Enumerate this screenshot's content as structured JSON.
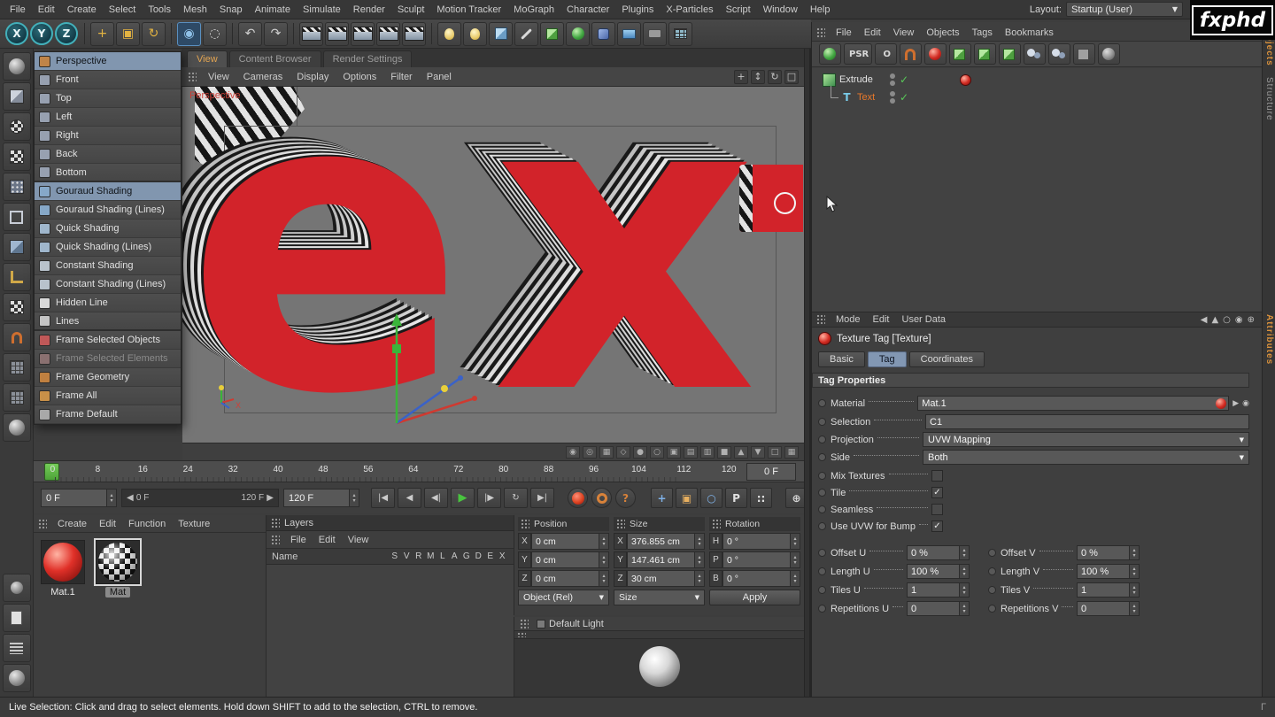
{
  "colors": {
    "accent_orange": "#e2a452",
    "selection_blue": "#8297b3",
    "viewport_gray": "#757575",
    "object_red": "#d2232a",
    "check_green": "#58c858"
  },
  "menubar": {
    "items": [
      "File",
      "Edit",
      "Create",
      "Select",
      "Tools",
      "Mesh",
      "Snap",
      "Animate",
      "Simulate",
      "Render",
      "Sculpt",
      "Motion Tracker",
      "MoGraph",
      "Character",
      "Plugins",
      "X-Particles",
      "Script",
      "Window",
      "Help"
    ],
    "layout_label": "Layout:",
    "layout_value": "Startup (User)",
    "logo": "fxphd"
  },
  "main_toolbar": {
    "axis": [
      {
        "name": "lock-x-axis-button",
        "glyph": "X"
      },
      {
        "name": "lock-y-axis-button",
        "glyph": "Y"
      },
      {
        "name": "lock-z-axis-button",
        "glyph": "Z"
      }
    ],
    "transform_tools": [
      {
        "name": "move-tool-button",
        "glyph": "+",
        "color": "#e3b341"
      },
      {
        "name": "scale-tool-button",
        "glyph": "▣",
        "color": "#e3b341"
      },
      {
        "name": "rotate-tool-button",
        "glyph": "↻",
        "color": "#e3b341"
      }
    ],
    "selection_tools": [
      {
        "name": "live-selection-tool-button",
        "glyph": "◉",
        "color": "#8fc1e8",
        "selected": true
      },
      {
        "name": "rectangle-selection-tool-button",
        "glyph": "◌",
        "color": "#cfcfcf"
      }
    ],
    "history": [
      {
        "name": "undo-button",
        "glyph": "↶"
      },
      {
        "name": "redo-button",
        "glyph": "↷"
      }
    ],
    "render_buttons": [
      {
        "name": "render-view-button"
      },
      {
        "name": "render-region-button"
      },
      {
        "name": "render-picture-viewer-button"
      },
      {
        "name": "render-team-button"
      },
      {
        "name": "render-settings-button"
      }
    ],
    "create_buttons": [
      {
        "name": "add-light-button",
        "shape": "bulb"
      },
      {
        "name": "add-light2-button",
        "shape": "bulb"
      },
      {
        "name": "add-cube-button",
        "shape": "bluecube"
      },
      {
        "name": "add-spline-button",
        "shape": "pen"
      },
      {
        "name": "add-generator-button",
        "shape": "greencube"
      },
      {
        "name": "add-mograph-button",
        "shape": "greenball"
      },
      {
        "name": "add-deformer-button",
        "shape": "bluedeform"
      },
      {
        "name": "add-environment-button",
        "shape": "sky"
      },
      {
        "name": "add-camera-button",
        "shape": "cam"
      },
      {
        "name": "add-array-button",
        "shape": "gridico"
      }
    ]
  },
  "left_toolbar": {
    "icons": [
      {
        "name": "make-editable-icon",
        "shape": "ball"
      },
      {
        "name": "model-mode-icon",
        "shape": "cube"
      },
      {
        "name": "texture-mode-icon",
        "shape": "checkerball"
      },
      {
        "name": "workplane-mode-icon",
        "shape": "checker"
      },
      {
        "name": "points-mode-icon",
        "shape": "dotcube"
      },
      {
        "name": "edges-mode-icon",
        "shape": "wirecube"
      },
      {
        "name": "polygons-mode-icon",
        "shape": "cube2"
      },
      {
        "name": "axis-mode-icon",
        "shape": "axis"
      },
      {
        "name": "texture-axis-mode-icon",
        "shape": "checker"
      },
      {
        "name": "snap-icon",
        "shape": "magnet"
      },
      {
        "name": "workplane-icon",
        "shape": "grid"
      },
      {
        "name": "locked-workplane-icon",
        "shape": "grid"
      },
      {
        "name": "viewport-solo-icon",
        "shape": "ball"
      }
    ],
    "bottom_icons": [
      {
        "name": "coordinates-icon",
        "shape": "grayball"
      },
      {
        "name": "content-browser-icon",
        "shape": "page"
      },
      {
        "name": "structure-list-icon",
        "shape": "lines"
      },
      {
        "name": "picture-viewer-icon",
        "shape": "ball"
      }
    ]
  },
  "view_menu": {
    "items": [
      {
        "label": "Perspective",
        "selected": true,
        "icon_color": "#c08448"
      },
      {
        "label": "Front",
        "icon_color": "#97a0b0"
      },
      {
        "label": "Top",
        "icon_color": "#97a0b0"
      },
      {
        "label": "Left",
        "icon_color": "#97a0b0"
      },
      {
        "label": "Right",
        "icon_color": "#97a0b0"
      },
      {
        "label": "Back",
        "icon_color": "#97a0b0"
      },
      {
        "label": "Bottom",
        "icon_color": "#97a0b0",
        "group_end": true
      },
      {
        "label": "Gouraud Shading",
        "selected": true,
        "icon_color": "#86a8c8"
      },
      {
        "label": "Gouraud Shading (Lines)",
        "icon_color": "#86a8c8"
      },
      {
        "label": "Quick Shading",
        "icon_color": "#9fb6cc"
      },
      {
        "label": "Quick Shading (Lines)",
        "icon_color": "#9fb6cc"
      },
      {
        "label": "Constant Shading",
        "icon_color": "#b8c2cc"
      },
      {
        "label": "Constant Shading (Lines)",
        "icon_color": "#b8c2cc"
      },
      {
        "label": "Hidden Line",
        "icon_color": "#d8d8d8"
      },
      {
        "label": "Lines",
        "icon_color": "#c4c4c4",
        "group_end": true
      },
      {
        "label": "Frame Selected Objects",
        "icon_color": "#c05858"
      },
      {
        "label": "Frame Selected Elements",
        "disabled": true,
        "icon_color": "#8a7070"
      },
      {
        "label": "Frame Geometry",
        "icon_color": "#c08040"
      },
      {
        "label": "Frame All",
        "icon_color": "#c89048"
      },
      {
        "label": "Frame Default",
        "icon_color": "#a8a8a8"
      }
    ]
  },
  "viewport": {
    "tabs": [
      {
        "label": "View",
        "active": true
      },
      {
        "label": "Content Browser"
      },
      {
        "label": "Render Settings"
      }
    ],
    "menu": [
      "View",
      "Cameras",
      "Display",
      "Options",
      "Filter",
      "Panel"
    ],
    "view_icons": [
      {
        "name": "pan-view-icon",
        "glyph": "+"
      },
      {
        "name": "dolly-view-icon",
        "glyph": "↕"
      },
      {
        "name": "rotate-view-icon",
        "glyph": "↻"
      },
      {
        "name": "maximize-view-icon",
        "glyph": "□"
      }
    ],
    "label": "Perspective",
    "object_text": "ex",
    "bottom_icons": [
      {
        "name": "camera-lock-icon",
        "glyph": "◉"
      },
      {
        "name": "camera-icon",
        "glyph": "◎"
      },
      {
        "name": "grid-toggle-icon",
        "glyph": "▦"
      },
      {
        "name": "axis-toggle-icon",
        "glyph": "◇"
      },
      {
        "name": "shading-icon",
        "glyph": "●"
      },
      {
        "name": "wireframe-icon",
        "glyph": "○"
      },
      {
        "name": "safe-frame-icon",
        "glyph": "▣"
      },
      {
        "name": "texture-toggle-icon",
        "glyph": "▤"
      },
      {
        "name": "backface-icon",
        "glyph": "▥"
      },
      {
        "name": "layer-icon",
        "glyph": "■"
      },
      {
        "name": "prev-view-icon",
        "glyph": "▲"
      },
      {
        "name": "next-view-icon",
        "glyph": "▼"
      },
      {
        "name": "region-icon",
        "glyph": "□"
      },
      {
        "name": "grid-icon",
        "glyph": "▦"
      }
    ]
  },
  "timeline": {
    "ticks": [
      "0",
      "8",
      "16",
      "24",
      "32",
      "40",
      "48",
      "56",
      "64",
      "72",
      "80",
      "88",
      "96",
      "104",
      "112",
      "120"
    ],
    "frame_box": "0 F"
  },
  "transport": {
    "frame_field": "0 F",
    "range_start": "0 F",
    "range_end": "120 F",
    "end_field": "120 F",
    "nav_buttons": [
      {
        "name": "goto-start-button",
        "text": "|◀"
      },
      {
        "name": "play-backward-button",
        "text": "◀"
      },
      {
        "name": "previous-frame-button",
        "text": "◀|"
      },
      {
        "name": "play-button",
        "text": "▶",
        "accent": true
      },
      {
        "name": "next-frame-button",
        "text": "|▶"
      },
      {
        "name": "loop-button",
        "text": "↻"
      },
      {
        "name": "goto-end-button",
        "text": "▶|"
      }
    ],
    "record_buttons": [
      {
        "name": "set-keyframe-button",
        "shape": "recred"
      },
      {
        "name": "autokey-button",
        "shape": "recring"
      },
      {
        "name": "keyframe-options-button",
        "text": "?",
        "color": "#d8823a"
      }
    ],
    "key_mode_buttons": [
      {
        "name": "record-position-button",
        "text": "+",
        "color": "#7fb2e8"
      },
      {
        "name": "record-scale-button",
        "text": "▣",
        "color": "#e8b060"
      },
      {
        "name": "record-rotation-button",
        "text": "○",
        "color": "#7fb2e8"
      },
      {
        "name": "record-parameter-button",
        "text": "P",
        "color": "#e0e0e0"
      },
      {
        "name": "record-pla-button",
        "text": "::",
        "color": "#e0e0e0"
      }
    ],
    "right_icons": [
      {
        "name": "keying-settings-icon",
        "text": "⊕"
      },
      {
        "name": "solo-icon",
        "text": "▦"
      }
    ]
  },
  "materials": {
    "menu": [
      "Create",
      "Edit",
      "Function",
      "Texture"
    ],
    "items": [
      {
        "name": "Mat.1",
        "selected": false
      },
      {
        "name": "Mat",
        "selected": true
      }
    ]
  },
  "layers": {
    "title": "Layers",
    "menu": [
      "File",
      "Edit",
      "View"
    ],
    "name_header": "Name",
    "flag_columns": [
      "S",
      "V",
      "R",
      "M",
      "L",
      "A",
      "G",
      "D",
      "E",
      "X"
    ]
  },
  "coordinates": {
    "headers": [
      "Position",
      "Size",
      "Rotation"
    ],
    "position": [
      {
        "axis": "X",
        "value": "0 cm"
      },
      {
        "axis": "Y",
        "value": "0 cm"
      },
      {
        "axis": "Z",
        "value": "0 cm"
      }
    ],
    "size": [
      {
        "axis": "X",
        "value": "376.855 cm"
      },
      {
        "axis": "Y",
        "value": "147.461 cm"
      },
      {
        "axis": "Z",
        "value": "30 cm"
      }
    ],
    "rotation": [
      {
        "axis": "H",
        "value": "0 °"
      },
      {
        "axis": "P",
        "value": "0 °"
      },
      {
        "axis": "B",
        "value": "0 °"
      }
    ],
    "object_mode": "Object (Rel)",
    "size_mode": "Size",
    "apply_label": "Apply"
  },
  "default_light": {
    "title": "Default Light"
  },
  "object_manager": {
    "menu": [
      "File",
      "Edit",
      "View",
      "Objects",
      "Tags",
      "Bookmarks"
    ],
    "toolbar": [
      {
        "name": "reset-psr-icon",
        "shape": "greenball"
      },
      {
        "name": "psr-button",
        "text": "PSR"
      },
      {
        "name": "origin-button",
        "text": "O"
      },
      {
        "name": "magnet-icon",
        "shape": "magnet"
      },
      {
        "name": "material-ball-icon",
        "shape": "redball"
      },
      {
        "name": "generator-icon",
        "shape": "greencube"
      },
      {
        "name": "generator2-icon",
        "shape": "greencube"
      },
      {
        "name": "generator3-icon",
        "shape": "greencube"
      },
      {
        "name": "instance-icon",
        "shape": "twoballs"
      },
      {
        "name": "array-icon",
        "shape": "twoballs"
      },
      {
        "name": "tool-icon",
        "shape": "gray"
      },
      {
        "name": "sphere-grid-icon",
        "shape": "grayball"
      }
    ],
    "objects": [
      {
        "name": "Extrude"
      },
      {
        "name": "Text",
        "selected": true
      }
    ]
  },
  "attributes": {
    "menu": [
      "Mode",
      "Edit",
      "User Data"
    ],
    "header_icons": [
      {
        "name": "back-icon",
        "glyph": "◀"
      },
      {
        "name": "up-icon",
        "glyph": "▲"
      },
      {
        "name": "search-icon",
        "glyph": "○"
      },
      {
        "name": "lock-icon",
        "glyph": "◉"
      },
      {
        "name": "add-icon",
        "glyph": "⊕"
      }
    ],
    "title": "Texture Tag [Texture]",
    "tabs": [
      {
        "label": "Basic"
      },
      {
        "label": "Tag",
        "active": true
      },
      {
        "label": "Coordinates"
      }
    ],
    "section_title": "Tag Properties",
    "material_label": "Material",
    "material_value": "Mat.1",
    "selection_label": "Selection",
    "selection_value": "C1",
    "projection_label": "Projection",
    "projection_value": "UVW Mapping",
    "side_label": "Side",
    "side_value": "Both",
    "checkboxes": [
      {
        "label": "Mix Textures",
        "checked": false
      },
      {
        "label": "Tile",
        "checked": true
      },
      {
        "label": "Seamless",
        "checked": false
      },
      {
        "label": "Use UVW for Bump",
        "checked": true
      }
    ],
    "uv_rows": [
      {
        "l_label": "Offset U",
        "l_value": "0 %",
        "r_label": "Offset V",
        "r_value": "0 %"
      },
      {
        "l_label": "Length U",
        "l_value": "100 %",
        "r_label": "Length V",
        "r_value": "100 %"
      },
      {
        "l_label": "Tiles U",
        "l_value": "1",
        "r_label": "Tiles V",
        "r_value": "1"
      },
      {
        "l_label": "Repetitions U",
        "l_value": "0",
        "r_label": "Repetitions V",
        "r_value": "0"
      }
    ]
  },
  "side_tabs": {
    "objects": "Objects",
    "structure": "Structure",
    "attributes": "Attributes"
  },
  "status_bar": {
    "text": "Live Selection: Click and drag to select elements. Hold down SHIFT to add to the selection, CTRL to remove.",
    "corner": "Γ"
  }
}
